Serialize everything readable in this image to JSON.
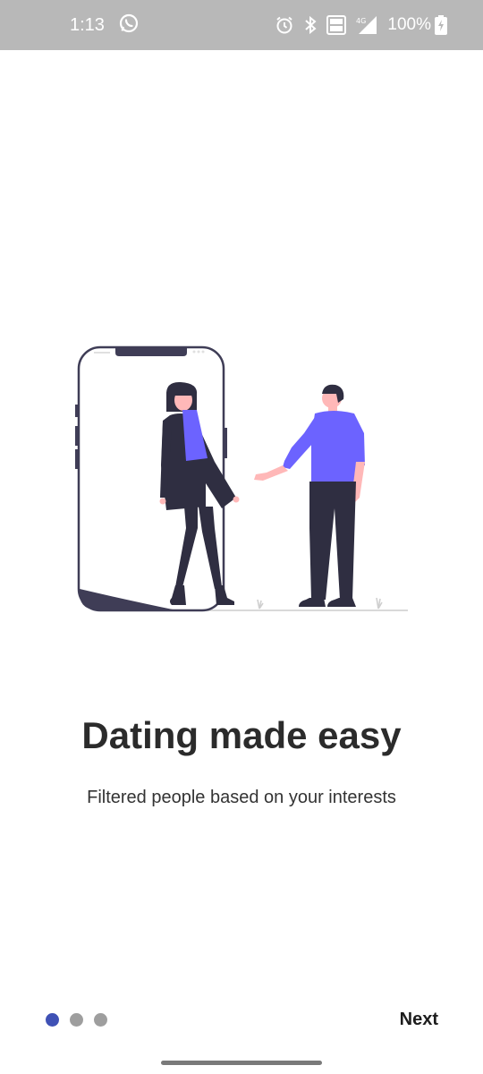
{
  "status_bar": {
    "time": "1:13",
    "battery": "100%",
    "icons": [
      "whatsapp-icon",
      "alarm-icon",
      "bluetooth-icon",
      "volte-icon",
      "signal-4g-icon",
      "battery-charging-icon"
    ]
  },
  "onboarding": {
    "title": "Dating made easy",
    "subtitle": "Filtered people based on your interests",
    "page_indicator": {
      "total": 3,
      "active": 1
    },
    "next_label": "Next"
  },
  "colors": {
    "accent": "#6c63ff",
    "dark": "#2f2e41",
    "indicator_active": "#3f51b5",
    "indicator_inactive": "#9e9e9e",
    "status_bar": "#b8b8b8"
  }
}
